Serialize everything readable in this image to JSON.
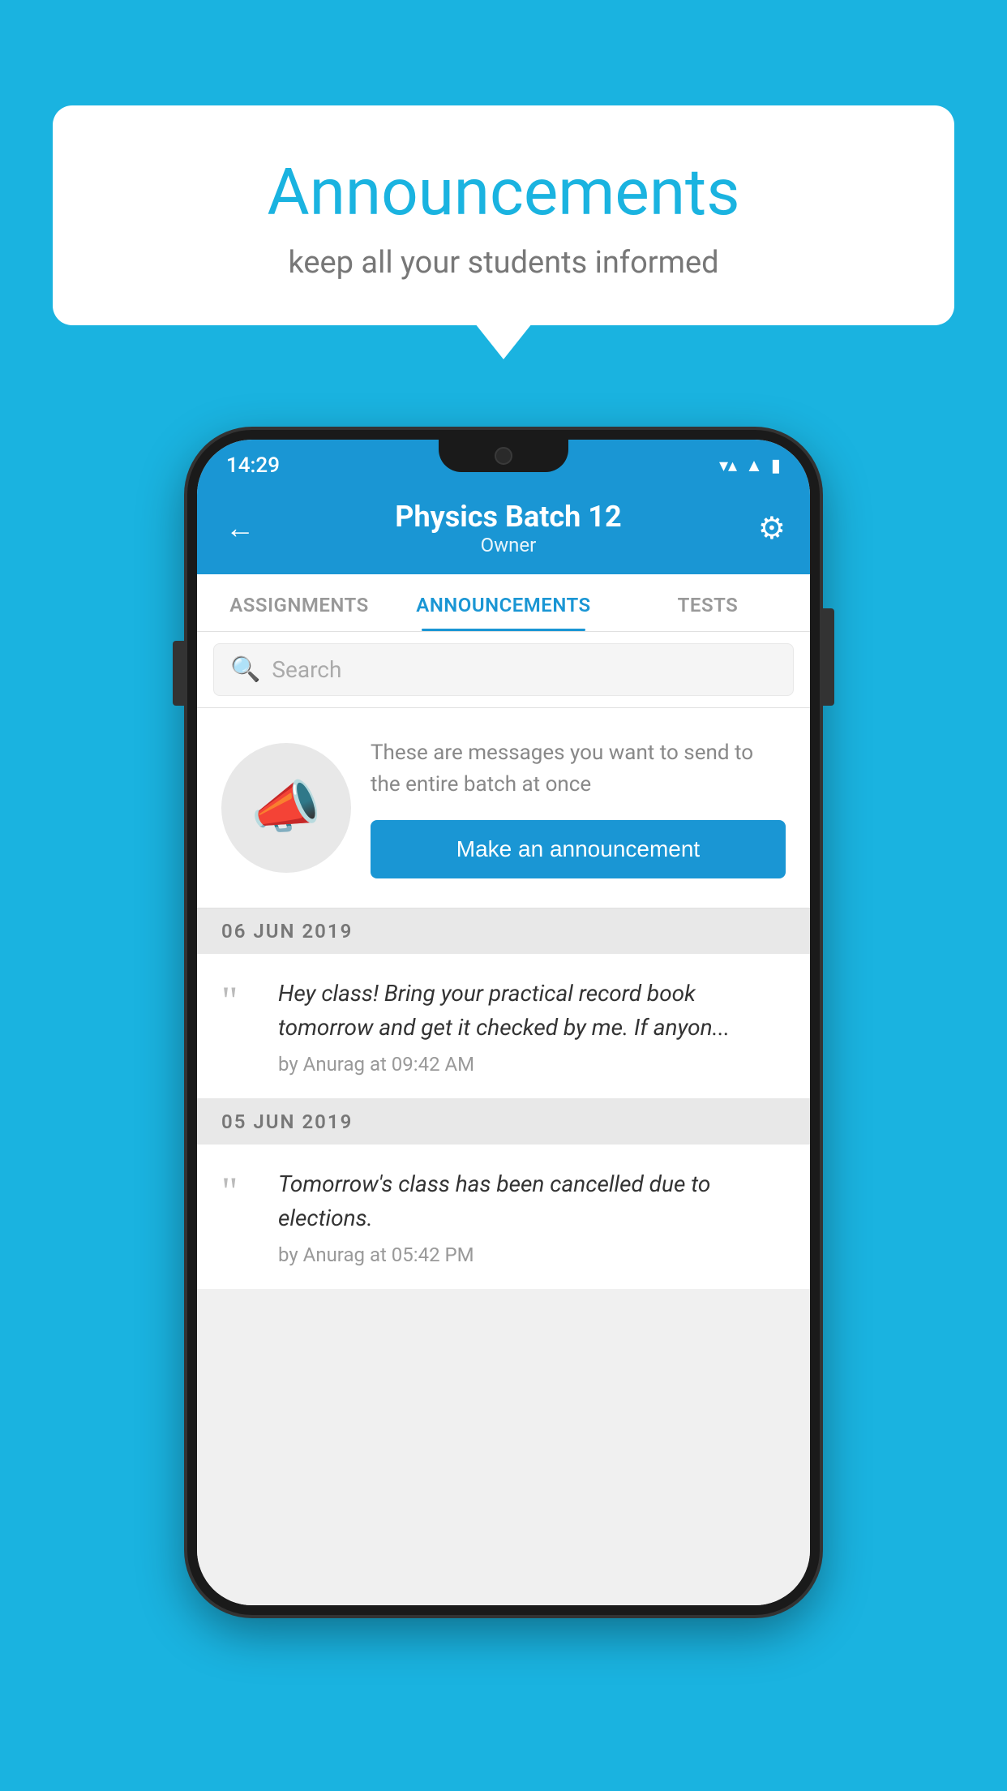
{
  "background_color": "#1ab3e0",
  "speech_bubble": {
    "title": "Announcements",
    "subtitle": "keep all your students informed"
  },
  "phone": {
    "status_bar": {
      "time": "14:29",
      "wifi": "▼",
      "signal": "▲",
      "battery": "▮"
    },
    "header": {
      "back_label": "←",
      "title": "Physics Batch 12",
      "subtitle": "Owner",
      "gear_label": "⚙"
    },
    "tabs": [
      {
        "label": "ASSIGNMENTS",
        "active": false
      },
      {
        "label": "ANNOUNCEMENTS",
        "active": true
      },
      {
        "label": "TESTS",
        "active": false
      },
      {
        "label": "...",
        "active": false
      }
    ],
    "search": {
      "placeholder": "Search"
    },
    "promo": {
      "description": "These are messages you want to send to the entire batch at once",
      "button_label": "Make an announcement"
    },
    "announcements": [
      {
        "date": "06  JUN  2019",
        "text": "Hey class! Bring your practical record book tomorrow and get it checked by me. If anyon...",
        "meta": "by Anurag at 09:42 AM"
      },
      {
        "date": "05  JUN  2019",
        "text": "Tomorrow's class has been cancelled due to elections.",
        "meta": "by Anurag at 05:42 PM"
      }
    ]
  }
}
